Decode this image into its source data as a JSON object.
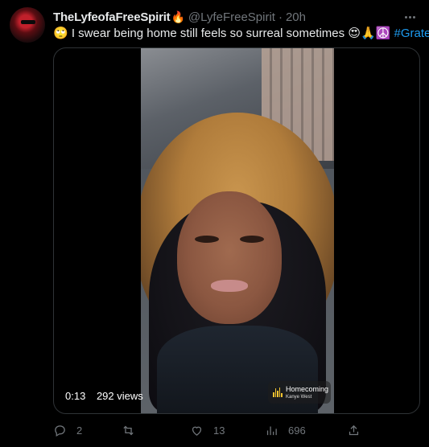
{
  "tweet": {
    "display_name": "TheLyfeofaFreeSpirit",
    "display_emoji": "🔥",
    "handle": "@LyfeFreeSpirit",
    "separator": "·",
    "time": "20h",
    "text_prefix": "🙄 I swear being home still feels so surreal sometimes 😍🙏☮️",
    "hashtag": "#Grateful"
  },
  "video": {
    "timestamp": "0:13",
    "views": "292 views",
    "song_title": "Homecoming",
    "song_artist": "Kanye West"
  },
  "actions": {
    "replies": "2",
    "retweets": "",
    "likes": "13",
    "views": "696"
  },
  "icons": {
    "more": "more-icon",
    "reply": "reply-icon",
    "retweet": "retweet-icon",
    "like": "heart-icon",
    "views": "views-icon",
    "share": "share-icon"
  },
  "colors": {
    "background": "#000000",
    "text": "#e7e9ea",
    "muted": "#71767b",
    "link": "#1d9bf0",
    "border": "#2f3336"
  }
}
